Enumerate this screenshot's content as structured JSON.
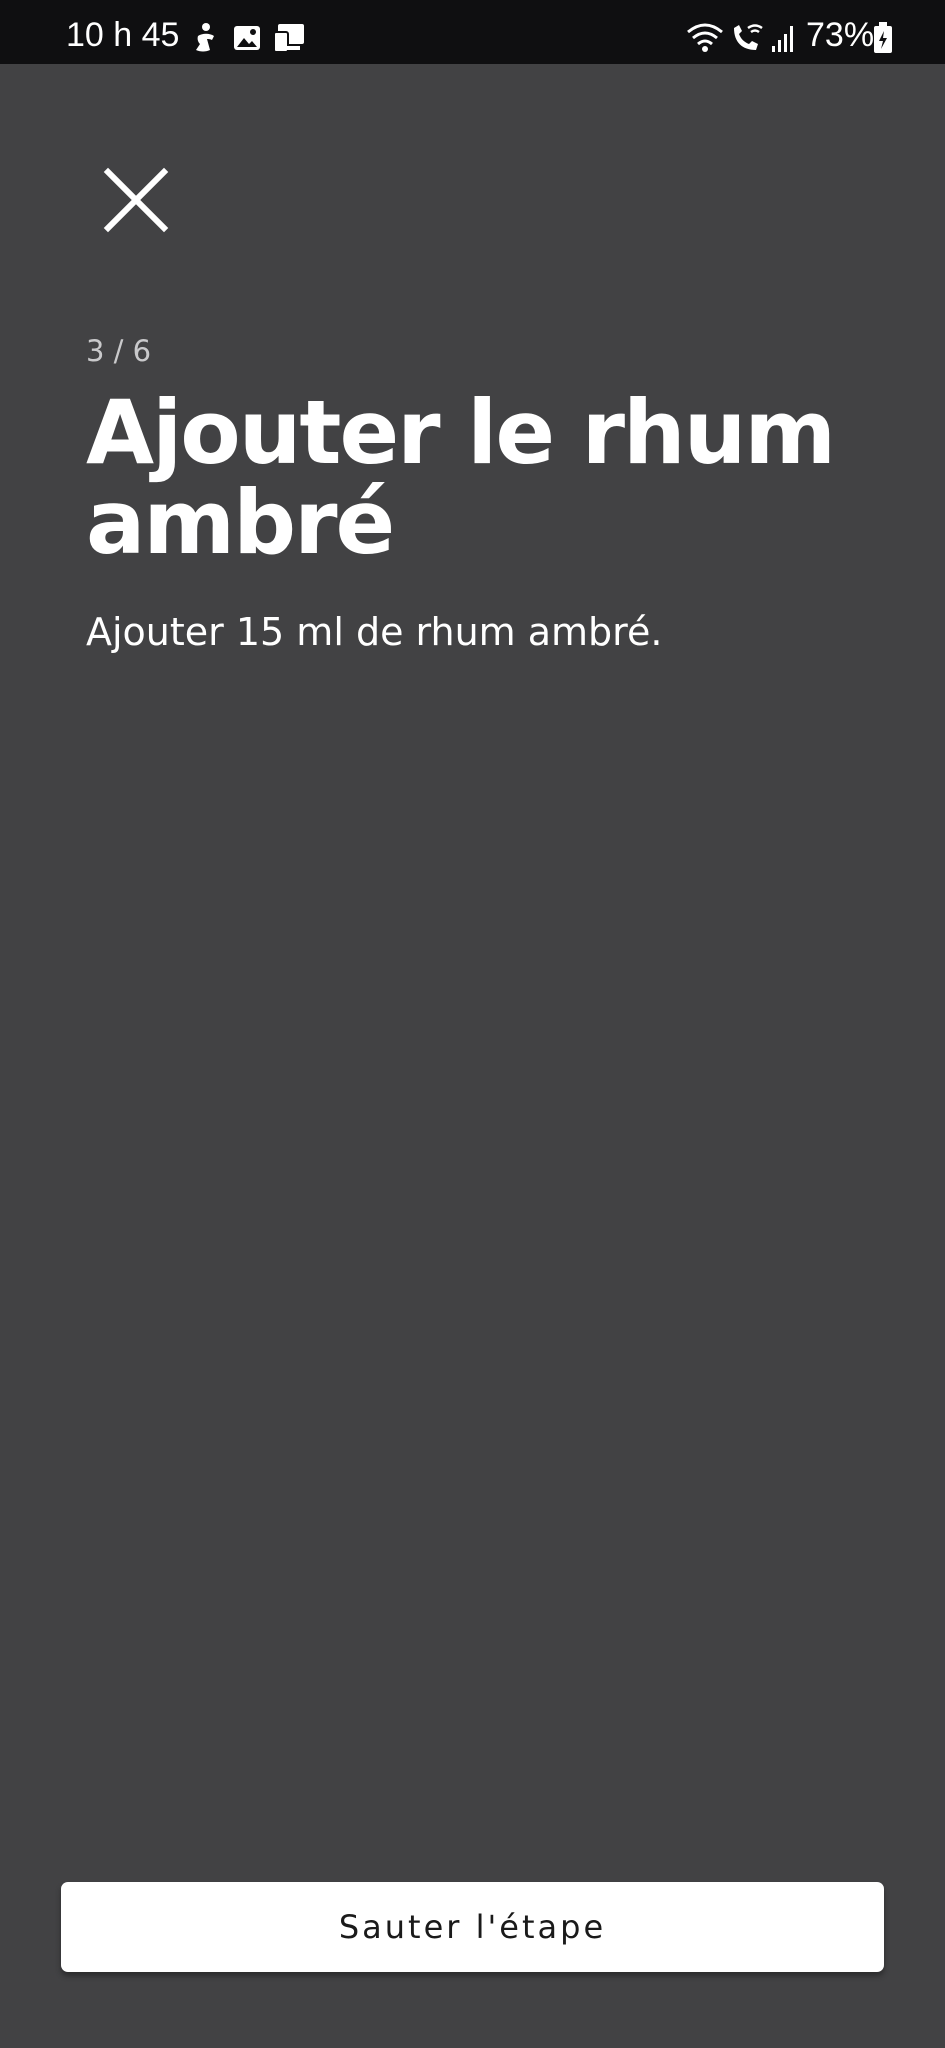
{
  "status_bar": {
    "time": "10 h 45",
    "battery": "73%",
    "left_icons": [
      "accessibility-person-icon",
      "image-icon",
      "screen-mirror-icon"
    ],
    "right_icons": [
      "wifi-icon",
      "wifi-call-icon",
      "signal-icon",
      "battery-charging-icon"
    ]
  },
  "step": {
    "counter": "3 / 6",
    "title": "Ajouter le rhum ambré",
    "description": "Ajouter 15 ml de rhum ambré."
  },
  "actions": {
    "close_icon": "close-icon",
    "skip_label": "Sauter l'étape"
  },
  "colors": {
    "background": "#424244",
    "status_bar": "#0f0f11",
    "button_bg": "#ffffff",
    "text_primary": "#ffffff"
  }
}
